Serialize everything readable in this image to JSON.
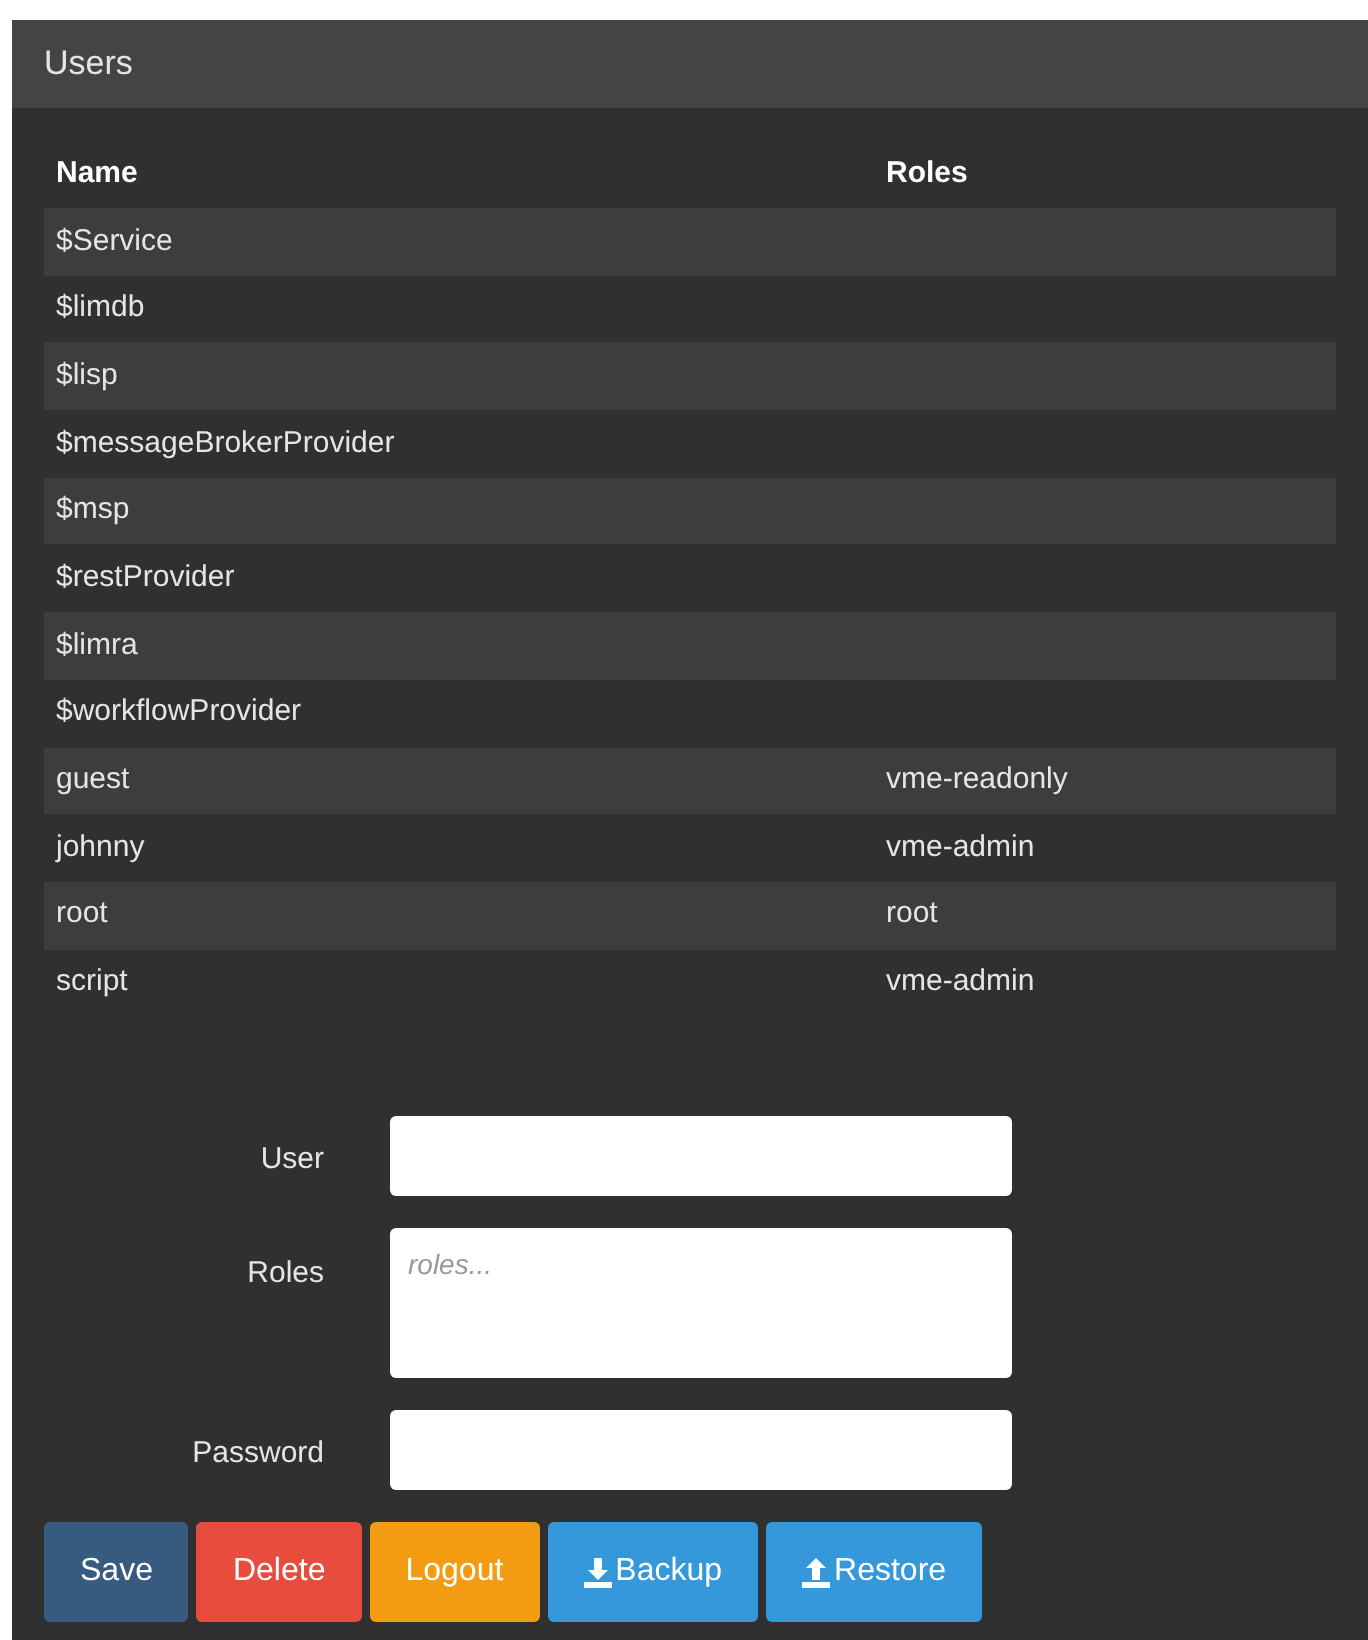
{
  "panel": {
    "title": "Users"
  },
  "table": {
    "columns": [
      "Name",
      "Roles"
    ],
    "rows": [
      {
        "name": "$Service",
        "roles": ""
      },
      {
        "name": "$limdb",
        "roles": ""
      },
      {
        "name": "$lisp",
        "roles": ""
      },
      {
        "name": "$messageBrokerProvider",
        "roles": ""
      },
      {
        "name": "$msp",
        "roles": ""
      },
      {
        "name": "$restProvider",
        "roles": ""
      },
      {
        "name": "$limra",
        "roles": ""
      },
      {
        "name": "$workflowProvider",
        "roles": ""
      },
      {
        "name": "guest",
        "roles": "vme-readonly"
      },
      {
        "name": "johnny",
        "roles": "vme-admin"
      },
      {
        "name": "root",
        "roles": "root"
      },
      {
        "name": "script",
        "roles": "vme-admin"
      }
    ]
  },
  "form": {
    "fields": [
      {
        "label": "User",
        "kind": "text"
      },
      {
        "label": "Roles",
        "kind": "textarea",
        "placeholder": "roles..."
      },
      {
        "label": "Password",
        "kind": "password"
      }
    ]
  },
  "buttons": [
    {
      "label": "Save",
      "color": "#375a7f",
      "kind": "plain"
    },
    {
      "label": "Delete",
      "color": "#e74c3c",
      "kind": "plain"
    },
    {
      "label": "Logout",
      "color": "#f39c12",
      "kind": "plain"
    },
    {
      "label": "Backup",
      "color": "#3498db",
      "kind": "download"
    },
    {
      "label": "Restore",
      "color": "#3498db",
      "kind": "upload"
    }
  ]
}
